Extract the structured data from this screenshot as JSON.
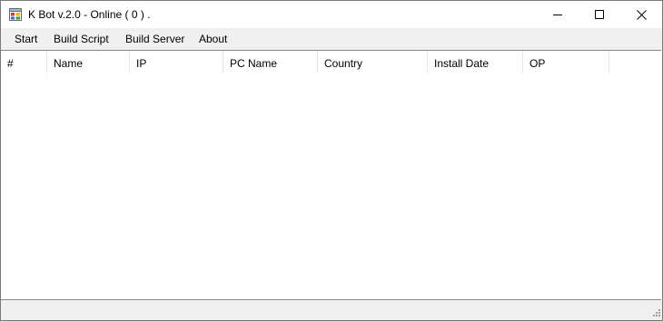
{
  "window": {
    "title": "K Bot v.2.0 - Online ( 0 ) .",
    "icon": "app-window-icon",
    "controls": [
      "minimize-icon",
      "maximize-icon",
      "close-icon"
    ]
  },
  "menu": {
    "items": [
      {
        "label": "Start"
      },
      {
        "label": "Build Script"
      },
      {
        "label": "Build Server"
      },
      {
        "label": "About"
      }
    ]
  },
  "table": {
    "columns": [
      "#",
      "Name",
      "IP",
      "PC Name",
      "Country",
      "Install Date",
      "OP"
    ],
    "rows": []
  },
  "colors": {
    "menubar_bg": "#f0f0f0",
    "window_border": "#7a7a7a",
    "header_divider": "#e5e5e5"
  }
}
